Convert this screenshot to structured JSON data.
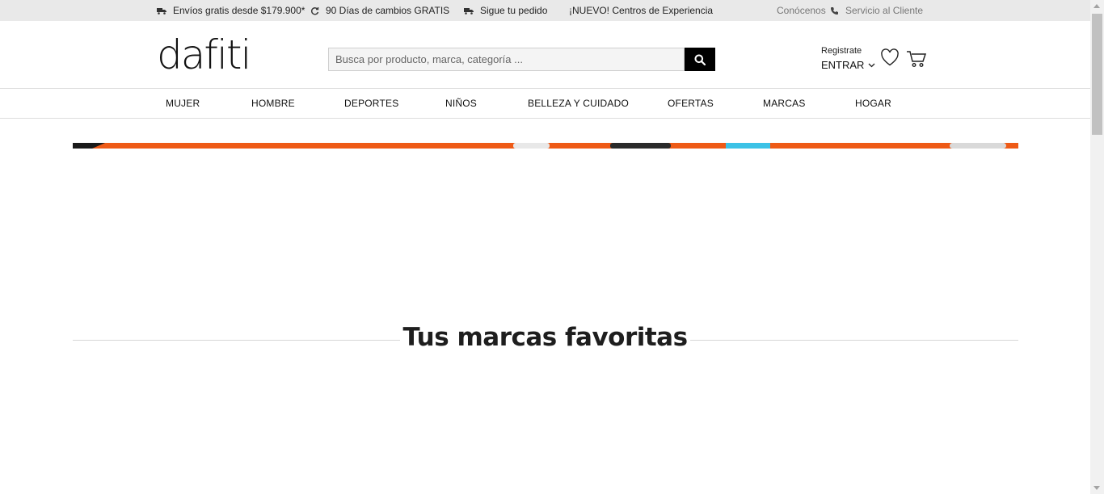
{
  "topbar": {
    "shipping": "Envíos gratis desde $179.900*",
    "returns": "90 Días de cambios GRATIS",
    "tracking": "Sigue tu pedido",
    "experience": "¡NUEVO! Centros de Experiencia",
    "about": "Conócenos",
    "service": "Servicio al Cliente"
  },
  "header": {
    "logo": "dafiti",
    "search_placeholder": "Busca por producto, marca, categoría ...",
    "register": "Registrate",
    "login": "ENTRAR"
  },
  "nav": {
    "items": [
      "MUJER",
      "HOMBRE",
      "DEPORTES",
      "NIÑOS",
      "BELLEZA Y CUIDADO",
      "OFERTAS",
      "MARCAS",
      "HOGAR"
    ]
  },
  "main": {
    "section_title": "Tus marcas favoritas"
  },
  "colors": {
    "banner_accent": "#ee5a16",
    "topbar_bg": "#e9e9e9",
    "search_button": "#000000"
  }
}
